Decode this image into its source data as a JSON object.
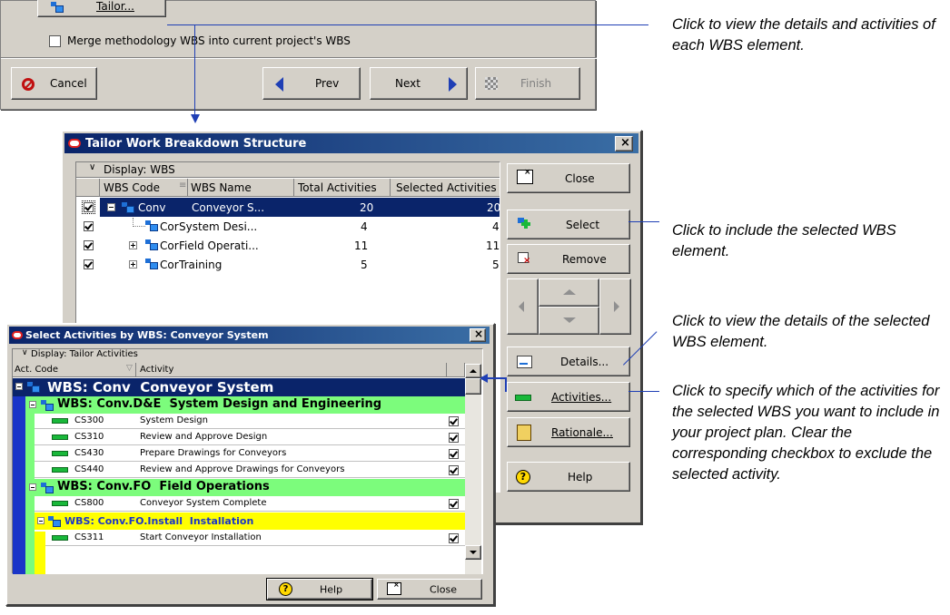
{
  "wizard": {
    "tailor_label": "Tailor...",
    "merge_label": "Merge methodology WBS into current project's WBS",
    "cancel_label": "Cancel",
    "prev_label": "Prev",
    "next_label": "Next",
    "finish_label": "Finish"
  },
  "tailor": {
    "title": "Tailor Work Breakdown Structure",
    "close_x": "×",
    "display_label": "Display: WBS",
    "columns": [
      "WBS Code",
      "WBS Name",
      "Total Activities",
      "Selected Activities"
    ],
    "rows": [
      {
        "code": "Conv",
        "name": "Conveyor S...",
        "total": "20",
        "selected": "20",
        "checked": true
      },
      {
        "code": "Cor",
        "name": "System Desi...",
        "total": "4",
        "selected": "4",
        "checked": true
      },
      {
        "code": "Cor",
        "name": "Field Operati...",
        "total": "11",
        "selected": "11",
        "checked": true
      },
      {
        "code": "Cor",
        "name": "Training",
        "total": "5",
        "selected": "5",
        "checked": true
      }
    ],
    "buttons": {
      "close": "Close",
      "select": "Select",
      "remove": "Remove",
      "details": "Details...",
      "activities": "Activities...",
      "rationale": "Rationale...",
      "help": "Help"
    }
  },
  "activities_dialog": {
    "title": "Select Activities by WBS: Conveyor System",
    "close_x": "×",
    "display_label": "Display: Tailor Activities",
    "columns": [
      "Act. Code",
      "Activity"
    ],
    "top_group": "WBS: Conv  Conveyor System",
    "group1": "WBS: Conv.D&E  System Design and Engineering",
    "group1_rows": [
      {
        "code": "CS300",
        "name": "System Design",
        "checked": true
      },
      {
        "code": "CS310",
        "name": "Review and Approve Design",
        "checked": true
      },
      {
        "code": "CS430",
        "name": "Prepare Drawings for Conveyors",
        "checked": true
      },
      {
        "code": "CS440",
        "name": "Review and Approve Drawings for Conveyors",
        "checked": true
      }
    ],
    "group2": "WBS: Conv.FO  Field Operations",
    "group2_rows": [
      {
        "code": "CS800",
        "name": "Conveyor System Complete",
        "checked": true
      }
    ],
    "group3": "WBS: Conv.FO.Install  Installation",
    "group3_rows": [
      {
        "code": "CS311",
        "name": "Start Conveyor Installation",
        "checked": true
      }
    ],
    "help_label": "Help",
    "close_label": "Close"
  },
  "annotations": {
    "a1": "Click to view the details and activities of each WBS element.",
    "a2": "Click to include the selected WBS element.",
    "a3": "Click to view the details of the selected WBS element.",
    "a4": "Click to specify which of the activities for the selected WBS you want to include in your project plan. Clear the corresponding checkbox to exclude the selected activity."
  },
  "colors": {
    "title_bar": "#0a246a",
    "selection": "#0a246a",
    "level1_band": "#7cfc7c",
    "level2_band": "#ffff00",
    "callout_line": "#1f3fb5"
  }
}
